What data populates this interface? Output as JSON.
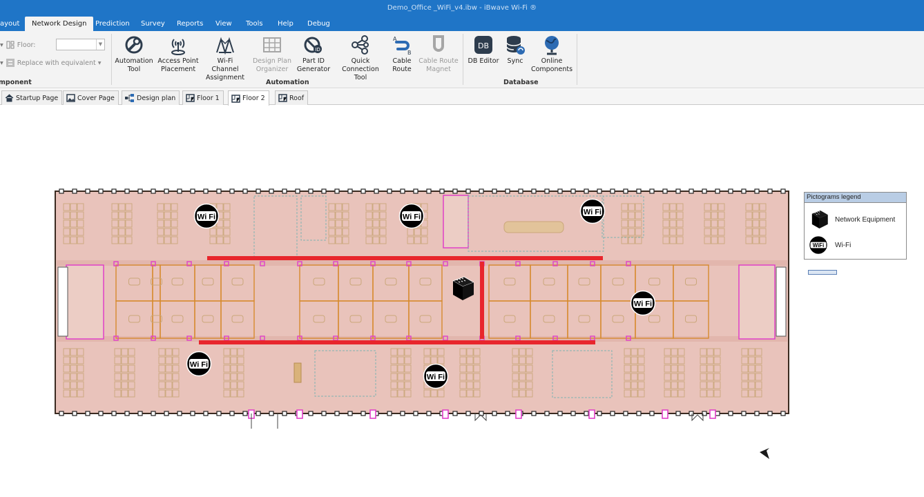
{
  "window": {
    "title": "Demo_Office _WiFi_v4.ibw - iBwave Wi-Fi ®"
  },
  "menu": [
    {
      "label": "ayout"
    },
    {
      "label": "Network Design",
      "active": true
    },
    {
      "label": "Prediction"
    },
    {
      "label": "Survey"
    },
    {
      "label": "Reports"
    },
    {
      "label": "View"
    },
    {
      "label": "Tools"
    },
    {
      "label": "Help"
    },
    {
      "label": "Debug"
    }
  ],
  "ribbon": {
    "floor_label": "Floor:",
    "floor_value": "",
    "replace_label": "Replace with equivalent ▾",
    "component_group": "mponent",
    "automation_group": "Automation",
    "database_group": "Database",
    "buttons": [
      {
        "label": "Automation\nTool",
        "icon": "wrench-gear-icon",
        "enabled": true
      },
      {
        "label": "Access Point\nPlacement",
        "icon": "access-point-icon",
        "enabled": true
      },
      {
        "label": "Wi-Fi Channel\nAssignment",
        "icon": "channel-assignment-icon",
        "enabled": true
      },
      {
        "label": "Design Plan\nOrganizer",
        "icon": "grid-organizer-icon",
        "enabled": false
      },
      {
        "label": "Part ID\nGenerator",
        "icon": "part-id-icon",
        "enabled": true
      },
      {
        "label": "Quick\nConnection Tool",
        "icon": "connection-tool-icon",
        "enabled": true
      },
      {
        "label": "Cable\nRoute",
        "icon": "cable-route-icon",
        "enabled": true
      },
      {
        "label": "Cable Route\nMagnet",
        "icon": "magnet-icon",
        "enabled": false
      },
      {
        "label": "DB Editor",
        "icon": "db-editor-icon",
        "enabled": true
      },
      {
        "label": "Sync",
        "icon": "database-sync-icon",
        "enabled": true
      },
      {
        "label": "Online\nComponents",
        "icon": "globe-icon",
        "enabled": true
      }
    ]
  },
  "tabs": [
    {
      "label": "Startup Page",
      "icon": "home-icon"
    },
    {
      "label": "Cover Page",
      "icon": "image-icon"
    },
    {
      "label": "Design plan",
      "icon": "design-plan-icon"
    },
    {
      "label": "Floor 1",
      "icon": "floor-icon"
    },
    {
      "label": "Floor 2",
      "icon": "floor-icon",
      "active": true
    },
    {
      "label": "Roof",
      "icon": "floor-icon"
    }
  ],
  "legend": {
    "title": "Pictograms legend",
    "items": [
      {
        "label": "Network Equipment",
        "icon": "network-equipment-icon"
      },
      {
        "label": "Wi-Fi",
        "icon": "wifi-pictogram-icon"
      }
    ]
  },
  "wifi_label": "Wi Fi",
  "colors": {
    "titlebar": "#1f75c7",
    "floor_fill": "#e9c3bb",
    "wall": "#d68a2e",
    "cable": "#e8262c",
    "pink_marker": "#e040c8"
  }
}
